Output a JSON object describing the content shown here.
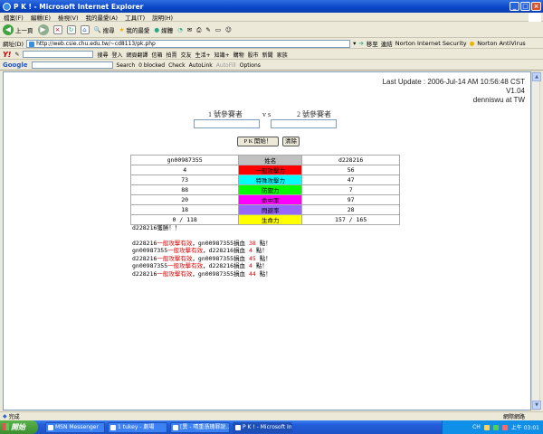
{
  "window": {
    "title": "P K ! - Microsoft Internet Explorer",
    "buttons": [
      "_",
      "□",
      "×"
    ]
  },
  "menu": [
    "檔案(F)",
    "編輯(E)",
    "檢視(V)",
    "我的最愛(A)",
    "工具(T)",
    "說明(H)"
  ],
  "toolbar": {
    "back": "上一頁",
    "search": "搜尋",
    "favorites": "我的最愛",
    "media": "媒體"
  },
  "address": {
    "label": "網址(D)",
    "url": "http://web.csie.chu.edu.tw/~cd8113/pk.php",
    "go": "移至",
    "links": "連結",
    "norton": "Norton Internet Security",
    "antivirus": "Norton AntiVirus"
  },
  "yahoo_bar": {
    "search": "搜尋",
    "signin": "登入",
    "items": [
      "網頁翻譯",
      "信箱",
      "拍賣",
      "交友",
      "生活+",
      "知識+",
      "購物",
      "股市",
      "新聞",
      "家族"
    ]
  },
  "google_bar": {
    "label": "Google",
    "search": "Search",
    "blocked": "0 blocked",
    "check": "Check",
    "autolink": "AutoLink",
    "autofill": "AutoFill",
    "options": "Options"
  },
  "page": {
    "last_update": "Last Update : 2006-Jul-14    AM 10:56:48 CST",
    "version": "V1.04",
    "author": "denniswu at TW",
    "player1_label": "1 號參賽者",
    "vs": "v s",
    "player2_label": "2 號參賽者",
    "player1_value": "",
    "player2_value": "",
    "pk_button": "P K 開始！",
    "clear_button": "清除"
  },
  "stats": {
    "header": {
      "p1": "gn00987355",
      "mid": "姓名",
      "p2": "d228216"
    },
    "rows": [
      {
        "p1": "4",
        "label": "一般攻擊力",
        "p2": "56",
        "color": "#ff0000"
      },
      {
        "p1": "73",
        "label": "特殊攻擊力",
        "p2": "47",
        "color": "#00ffff"
      },
      {
        "p1": "88",
        "label": "防禦力",
        "p2": "7",
        "color": "#00ff00"
      },
      {
        "p1": "20",
        "label": "命中率",
        "p2": "97",
        "color": "#ff00ff"
      },
      {
        "p1": "18",
        "label": "閃避率",
        "p2": "28",
        "color": "#9966ff"
      },
      {
        "p1": "0  /  118",
        "label": "生命力",
        "p2": "157  /  165",
        "color": "#ffff00"
      }
    ],
    "header_color": "#c0c0c0"
  },
  "log": {
    "winner": "d228216獲勝！！",
    "lines": [
      {
        "a": "d228216",
        "act": "一般攻擊有效",
        "b": "gn00987355",
        "dmg": "38"
      },
      {
        "a": "gn00987355",
        "act": "一般攻擊有效",
        "b": "d228216",
        "dmg": "4"
      },
      {
        "a": "d228216",
        "act": "一般攻擊有效",
        "b": "gn00987355",
        "dmg": "45"
      },
      {
        "a": "gn00987355",
        "act": "一般攻擊有效",
        "b": "d228216",
        "dmg": "4"
      },
      {
        "a": "d228216",
        "act": "一般攻擊有效",
        "b": "gn00987355",
        "dmg": "44"
      }
    ],
    "sep": "，",
    "mid": "損血",
    "end": "點！"
  },
  "status": {
    "left": "完成",
    "zone": "網際網路"
  },
  "taskbar": {
    "start": "開始",
    "tasks": [
      "MSN Messenger",
      "1 tukey - 劇場",
      "[異 - 晴重憑瑰罪說…",
      "P K ! - Microsoft Int…"
    ],
    "lang": "CH",
    "clock": "上午 03:01"
  }
}
